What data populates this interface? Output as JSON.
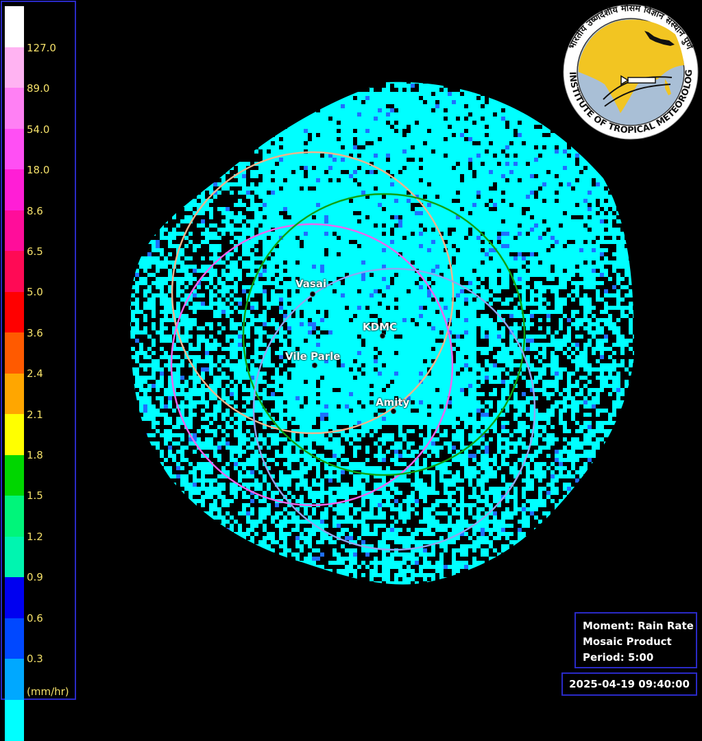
{
  "legend": {
    "units": "(mm/hr)",
    "ticks": [
      "127.0",
      "89.0",
      "54.0",
      "18.0",
      "8.6",
      "6.5",
      "5.0",
      "3.6",
      "2.4",
      "2.1",
      "1.8",
      "1.5",
      "1.2",
      "0.9",
      "0.6",
      "0.3"
    ],
    "colors": [
      "#ffffff",
      "#ffb3f2",
      "#ff80f4",
      "#ff4ff4",
      "#ff1ed6",
      "#ff0d9a",
      "#ff0a55",
      "#ff0000",
      "#ff5a00",
      "#ffa600",
      "#ffff00",
      "#00d600",
      "#00f57a",
      "#00f5b0",
      "#0000f0",
      "#0048ff",
      "#00a8ff",
      "#00ffff"
    ]
  },
  "info": {
    "moment": "Moment: Rain Rate",
    "product": "Mosaic Product",
    "period": "Period: 5:00"
  },
  "timestamp": "2025-04-19 09:40:00",
  "stations": {
    "vasai": "Vasai",
    "kdmc": "KDMC",
    "vile_parle": "Vile Parle",
    "amity": "Amity"
  },
  "logo": {
    "text": "भारतीय उष्णदेशीय मौसम विज्ञान संस्थान पुणे INDIAN INSTITUTE OF TROPICAL METEOROLOGY PUNE",
    "colors": {
      "land": "#f2c522",
      "sea": "#a9bfd6",
      "ring": "#ffffff"
    }
  },
  "radar_rings": [
    "#f0b48c",
    "#ef64ef",
    "#10a010",
    "#8ea6f2"
  ],
  "echo_color": "#00ffff"
}
